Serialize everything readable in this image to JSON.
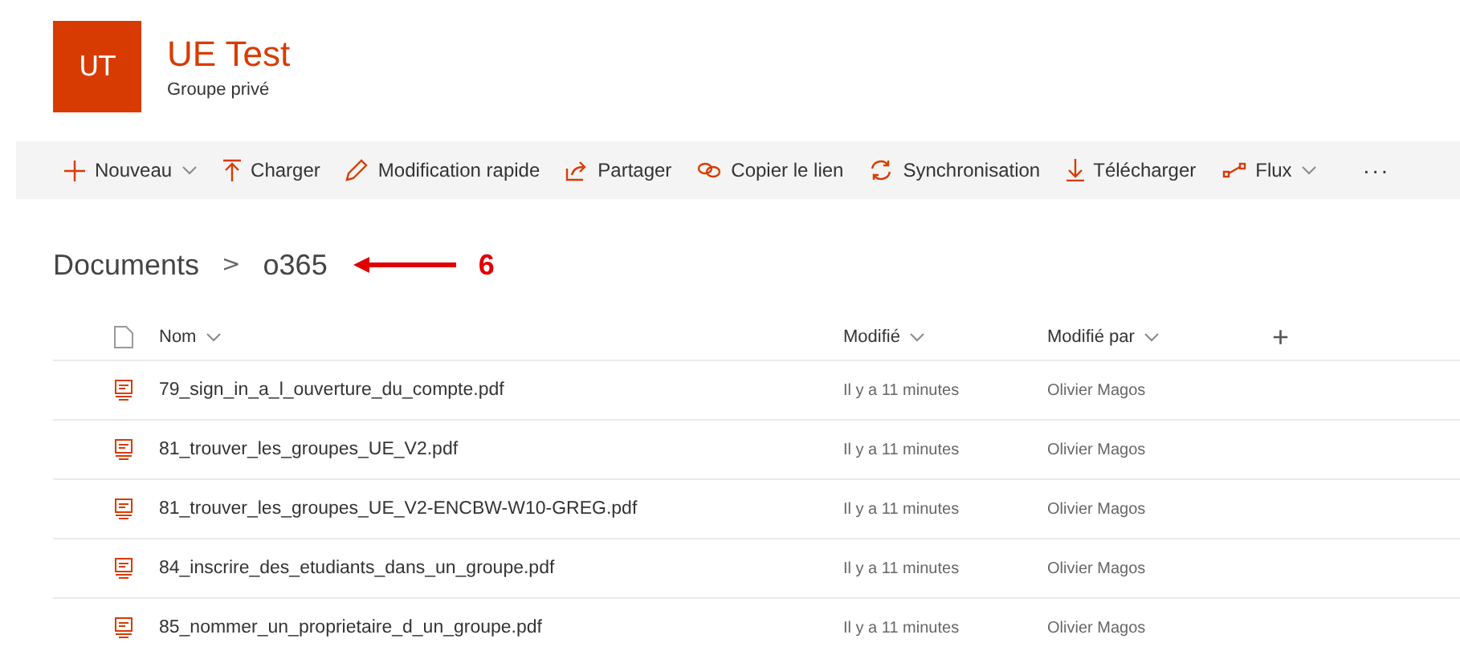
{
  "site": {
    "logo": "UT",
    "title": "UE Test",
    "subtitle": "Groupe privé"
  },
  "toolbar": [
    {
      "kind": "new",
      "label": "Nouveau",
      "has_menu": true
    },
    {
      "kind": "upload",
      "label": "Charger",
      "has_menu": false
    },
    {
      "kind": "edit",
      "label": "Modification rapide",
      "has_menu": false
    },
    {
      "kind": "share",
      "label": "Partager",
      "has_menu": false
    },
    {
      "kind": "link",
      "label": "Copier le lien",
      "has_menu": false
    },
    {
      "kind": "sync",
      "label": "Synchronisation",
      "has_menu": false
    },
    {
      "kind": "download",
      "label": "Télécharger",
      "has_menu": false
    },
    {
      "kind": "flow",
      "label": "Flux",
      "has_menu": true
    },
    {
      "kind": "more",
      "label": "···",
      "has_menu": false
    }
  ],
  "breadcrumb": [
    "Documents",
    "o365"
  ],
  "breadcrumb_separator": ">",
  "annotation": {
    "label": "6"
  },
  "table": {
    "columns": [
      "Nom",
      "Modifié",
      "Modifié par"
    ],
    "add_column": "+",
    "rows": [
      {
        "name": "79_sign_in_a_l_ouverture_du_compte.pdf",
        "modified": "Il y a 11 minutes",
        "modified_by": "Olivier Magos"
      },
      {
        "name": "81_trouver_les_groupes_UE_V2.pdf",
        "modified": "Il y a 11 minutes",
        "modified_by": "Olivier Magos"
      },
      {
        "name": "81_trouver_les_groupes_UE_V2-ENCBW-W10-GREG.pdf",
        "modified": "Il y a 11 minutes",
        "modified_by": "Olivier Magos"
      },
      {
        "name": "84_inscrire_des_etudiants_dans_un_groupe.pdf",
        "modified": "Il y a 11 minutes",
        "modified_by": "Olivier Magos"
      },
      {
        "name": "85_nommer_un_proprietaire_d_un_groupe.pdf",
        "modified": "Il y a 11 minutes",
        "modified_by": "Olivier Magos"
      }
    ]
  }
}
